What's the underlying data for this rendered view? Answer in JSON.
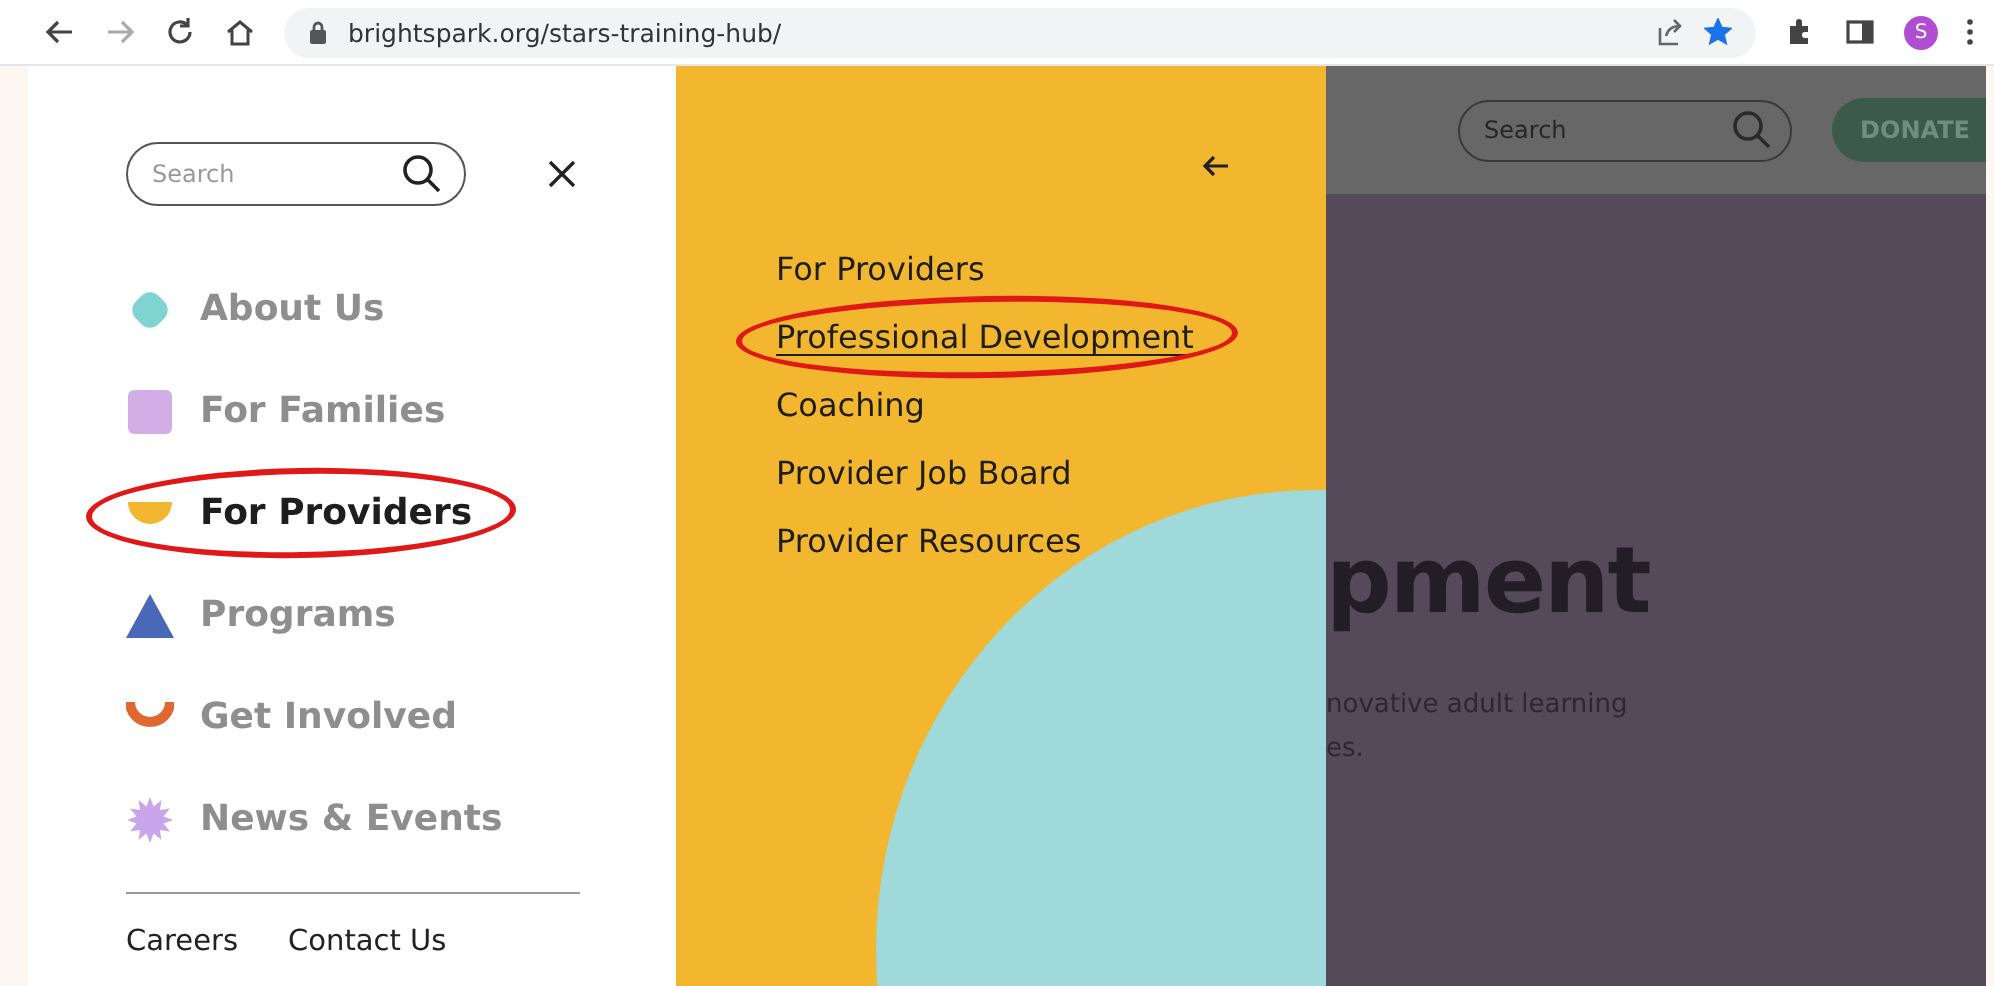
{
  "browser": {
    "url": "brightspark.org/stars-training-hub/",
    "bookmarked": true,
    "profile_initial": "S"
  },
  "nav": {
    "search": {
      "placeholder": "Search"
    },
    "items": [
      {
        "label": "About Us",
        "kind": "flower",
        "color": "#7fd3d0",
        "selected": false,
        "circled": false
      },
      {
        "label": "For Families",
        "kind": "square",
        "color": "#d3aee6",
        "selected": false,
        "circled": false
      },
      {
        "label": "For Providers",
        "kind": "half-circle",
        "color": "#f2b630",
        "selected": true,
        "circled": true
      },
      {
        "label": "Programs",
        "kind": "triangle",
        "color": "#4a68b8",
        "selected": false,
        "circled": false
      },
      {
        "label": "Get Involved",
        "kind": "cup",
        "color": "#e0672f",
        "selected": false,
        "circled": false
      },
      {
        "label": "News & Events",
        "kind": "burst",
        "color": "#c9a6ec",
        "selected": false,
        "circled": false
      }
    ],
    "footer_links": [
      "Careers",
      "Contact Us"
    ]
  },
  "submenu": {
    "items": [
      {
        "label": "For Providers",
        "selected": false,
        "circled": false
      },
      {
        "label": "Professional Development",
        "selected": true,
        "circled": true
      },
      {
        "label": "Coaching",
        "selected": false,
        "circled": false
      },
      {
        "label": "Provider Job Board",
        "selected": false,
        "circled": false
      },
      {
        "label": "Provider Resources",
        "selected": false,
        "circled": false
      }
    ]
  },
  "page_behind": {
    "search": {
      "placeholder": "Search"
    },
    "donate": "DONATE",
    "heading": "pment",
    "body_lines": [
      "novative adult learning",
      "es."
    ]
  }
}
